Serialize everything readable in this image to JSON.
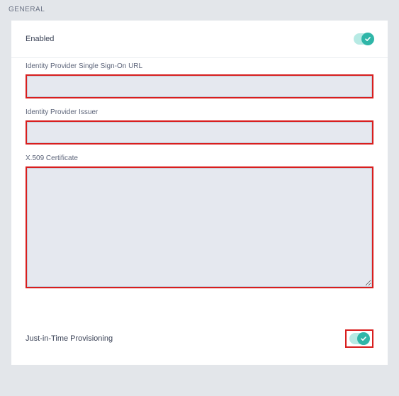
{
  "section_title": "GENERAL",
  "enabled": {
    "label": "Enabled",
    "on": true
  },
  "fields": {
    "sso_url": {
      "label": "Identity Provider Single Sign-On URL",
      "value": "",
      "placeholder": ""
    },
    "issuer": {
      "label": "Identity Provider Issuer",
      "value": "",
      "placeholder": ""
    },
    "cert": {
      "label": "X.509 Certificate",
      "value": "",
      "placeholder": ""
    }
  },
  "jit": {
    "label": "Just-in-Time Provisioning",
    "on": true
  }
}
